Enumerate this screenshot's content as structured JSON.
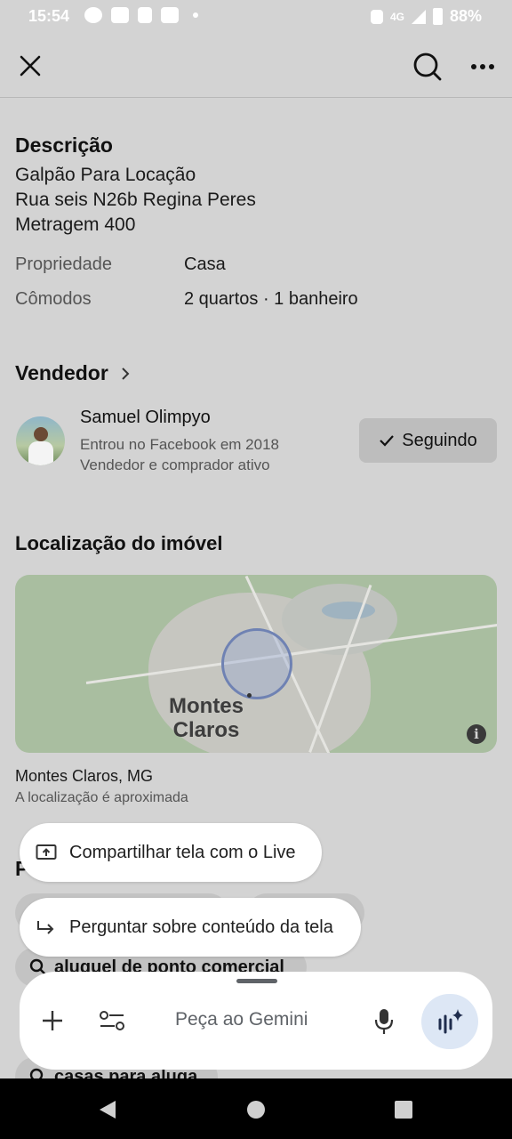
{
  "status_bar": {
    "time": "15:54",
    "network": "4G",
    "battery": "88%"
  },
  "description": {
    "heading": "Descrição",
    "lines": [
      "Galpão Para Locação",
      "Rua seis N26b Regina Peres",
      "Metragem 400"
    ]
  },
  "details": [
    {
      "label": "Propriedade",
      "value": "Casa"
    },
    {
      "label": "Cômodos",
      "value": "2 quartos · 1 banheiro"
    }
  ],
  "seller": {
    "heading": "Vendedor",
    "name": "Samuel Olimpyo",
    "joined": "Entrou no Facebook em 2018",
    "activity": "Vendedor e comprador ativo",
    "follow_label": "Seguindo"
  },
  "location": {
    "heading": "Localização do imóvel",
    "map_city_line1": "Montes",
    "map_city_line2": "Claros",
    "city": "Montes Claros, MG",
    "note": "A localização é aproximada"
  },
  "partial_section_initial": "P",
  "suggestions": [
    {
      "label": "aluguel de ponto comercial"
    },
    {
      "label": "casas para aluga"
    }
  ],
  "overlay": {
    "share_screen_label": "Compartilhar tela com o Live",
    "ask_screen_label": "Perguntar sobre conteúdo da tela",
    "prompt_placeholder": "Peça ao Gemini"
  }
}
